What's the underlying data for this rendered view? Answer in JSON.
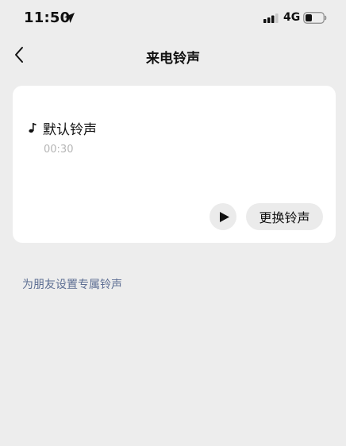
{
  "status_bar": {
    "time": "11:50",
    "network": "4G"
  },
  "nav": {
    "title": "来电铃声"
  },
  "ringtone": {
    "name": "默认铃声",
    "duration": "00:30"
  },
  "actions": {
    "change_label": "更换铃声"
  },
  "link": {
    "friend_ringtone": "为朋友设置专属铃声"
  },
  "colors": {
    "background": "#ededed",
    "card": "#ffffff",
    "link": "#5d6e93",
    "muted_text": "#b5b5b5",
    "button_bg": "#ebebeb"
  }
}
